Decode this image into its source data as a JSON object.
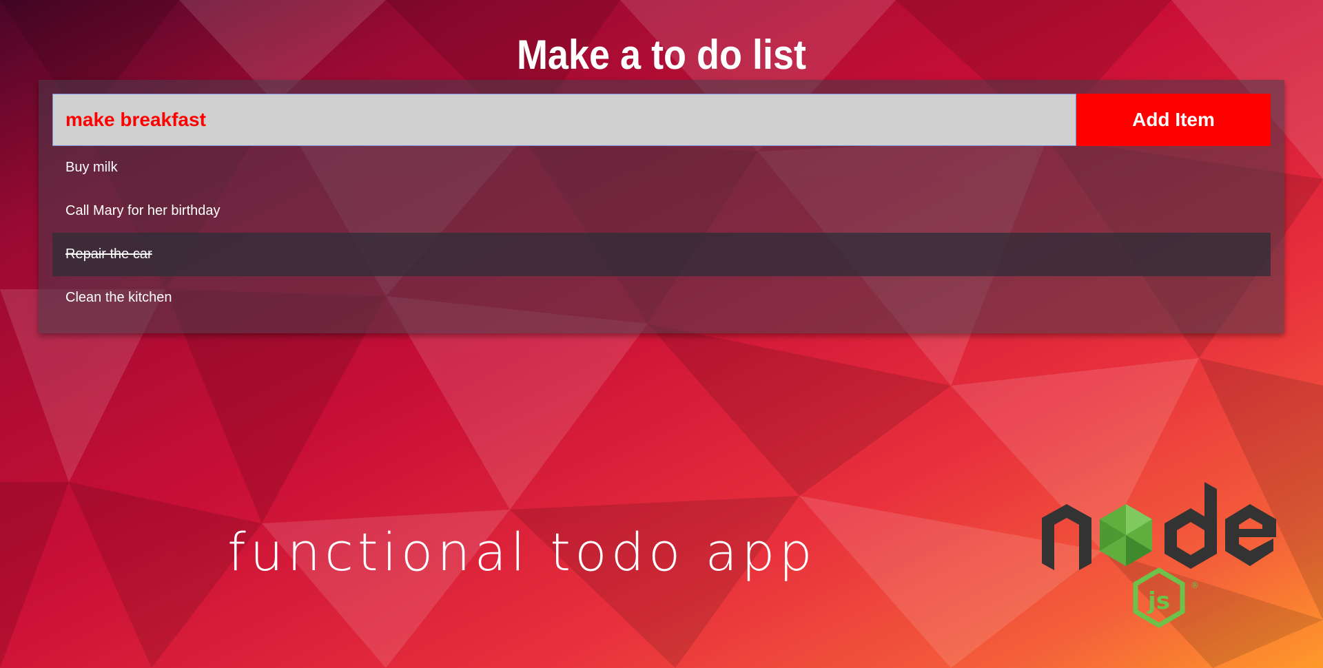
{
  "page": {
    "title": "Make a to do list"
  },
  "form": {
    "input_value": "make breakfast",
    "add_button_label": "Add Item"
  },
  "todos": [
    {
      "text": "Buy milk",
      "done": false
    },
    {
      "text": "Call Mary for her birthday",
      "done": false
    },
    {
      "text": "Repair the car",
      "done": true
    },
    {
      "text": "Clean the kitchen",
      "done": false
    }
  ],
  "tagline": "functional todo app",
  "logo": {
    "icon": "nodejs-logo-icon"
  },
  "colors": {
    "accent": "#ff0000",
    "input_bg": "#d0d0d0",
    "input_text": "#ff0000",
    "panel_overlay": "#46404b",
    "logo_dark": "#333333",
    "logo_green": "#6cc24a"
  }
}
